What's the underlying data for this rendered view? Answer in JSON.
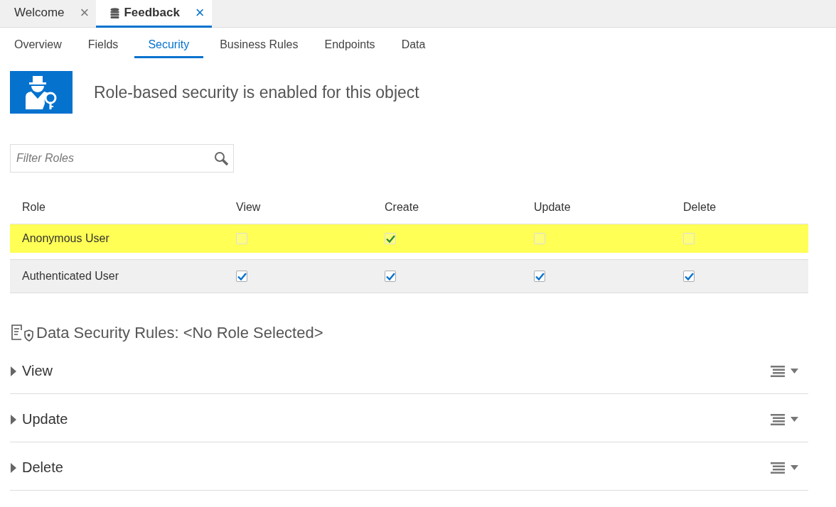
{
  "doc_tabs": [
    {
      "label": "Welcome",
      "selected": false,
      "close": "×"
    },
    {
      "label": "Feedback",
      "selected": true,
      "close": "×"
    }
  ],
  "sub_tabs": [
    {
      "label": "Overview",
      "selected": false
    },
    {
      "label": "Fields",
      "selected": false
    },
    {
      "label": "Security",
      "selected": true
    },
    {
      "label": "Business Rules",
      "selected": false
    },
    {
      "label": "Endpoints",
      "selected": false
    },
    {
      "label": "Data",
      "selected": false
    }
  ],
  "banner": {
    "message": "Role-based security is enabled for this object"
  },
  "filter": {
    "placeholder": "Filter Roles"
  },
  "roles_table": {
    "columns": [
      "Role",
      "View",
      "Create",
      "Update",
      "Delete"
    ],
    "rows": [
      {
        "role": "Anonymous User",
        "selected": true,
        "permissions": [
          false,
          true,
          false,
          false
        ]
      },
      {
        "role": "Authenticated User",
        "selected": false,
        "permissions": [
          true,
          true,
          true,
          true
        ]
      }
    ]
  },
  "data_security": {
    "title": "Data Security Rules: <No Role Selected>",
    "sections": [
      {
        "label": "View",
        "expanded": false
      },
      {
        "label": "Update",
        "expanded": false
      },
      {
        "label": "Delete",
        "expanded": false
      }
    ]
  }
}
